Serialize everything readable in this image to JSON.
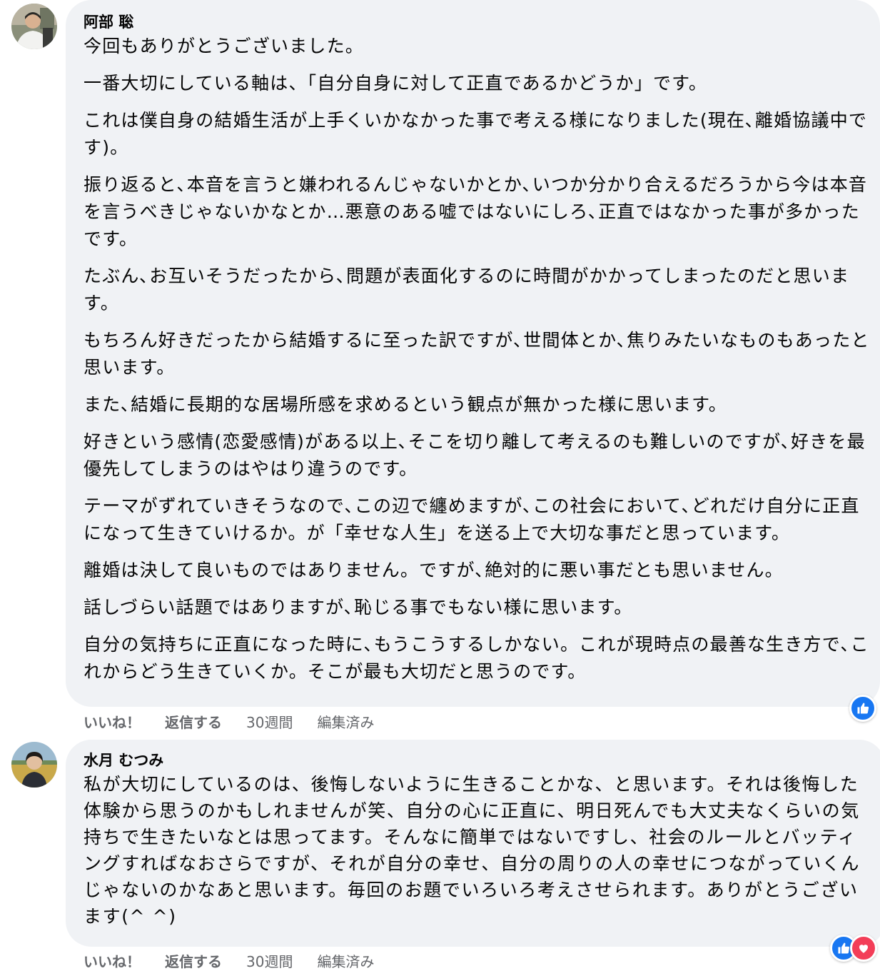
{
  "comments": [
    {
      "author": "阿部 聡",
      "paragraphs": [
        "今回もありがとうございました。",
        "一番大切にしている軸は、「自分自身に対して正直であるかどうか」です。",
        "これは僕自身の結婚生活が上手くいかなかった事で考える様になりました(現在､離婚協議中です)。",
        "振り返ると､本音を言うと嫌われるんじゃないかとか､いつか分かり合えるだろうから今は本音を言うべきじゃないかなとか…悪意のある嘘ではないにしろ､正直ではなかった事が多かったです。",
        "たぶん､お互いそうだったから､問題が表面化するのに時間がかかってしまったのだと思います。",
        "もちろん好きだったから結婚するに至った訳ですが､世間体とか､焦りみたいなものもあったと思います。",
        "また､結婚に長期的な居場所感を求めるという観点が無かった様に思います。",
        "好きという感情(恋愛感情)がある以上､そこを切り離して考えるのも難しいのですが､好きを最優先してしまうのはやはり違うのです。",
        "テーマがずれていきそうなので､この辺で纏めますが､この社会において､どれだけ自分に正直になって生きていけるか。が「幸せな人生」を送る上で大切な事だと思っています。",
        "離婚は決して良いものではありません。ですが､絶対的に悪い事だとも思いません。",
        "話しづらい話題ではありますが､恥じる事でもない様に思います。",
        "自分の気持ちに正直になった時に､もうこうするしかない。これが現時点の最善な生き方で､これからどう生きていくか。そこが最も大切だと思うのです。"
      ],
      "actions": {
        "like": "いいね！",
        "reply": "返信する",
        "time": "30週間",
        "edited": "編集済み"
      },
      "reactions": [
        "like-icon"
      ]
    },
    {
      "author": "水月 むつみ",
      "paragraphs": [
        "私が大切にしているのは、後悔しないように生きることかな、と思います。それは後悔した体験から思うのかもしれませんが笑、自分の心に正直に、明日死んでも大丈夫なくらいの気持ちで生きたいなとは思ってます。そんなに簡単ではないですし、社会のルールとバッティングすればなおさらですが、それが自分の幸せ、自分の周りの人の幸せにつながっていくんじゃないのかなあと思います。毎回のお題でいろいろ考えさせられます。ありがとうございます(^ ^)"
      ],
      "actions": {
        "like": "いいね！",
        "reply": "返信する",
        "time": "30週間",
        "edited": "編集済み"
      },
      "reactions": [
        "like-icon",
        "heart-icon"
      ]
    }
  ],
  "colors": {
    "bubble": "#f0f2f5",
    "meta_text": "#65676b",
    "like_blue": "#1877f2",
    "love_red": "#f33e58"
  }
}
